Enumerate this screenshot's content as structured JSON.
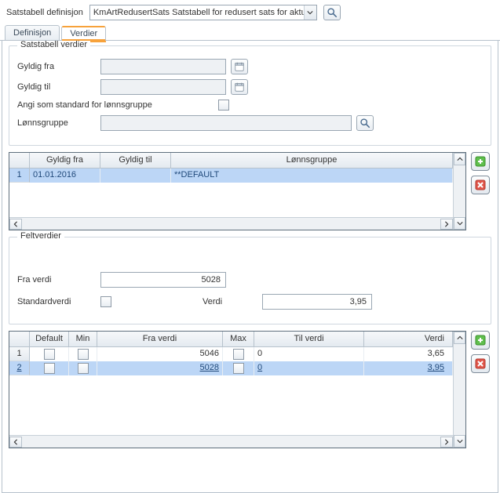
{
  "top": {
    "label": "Satstabell definisjon",
    "combo_value": "KmArtRedusertSats Satstabell for redusert sats for aktuell art"
  },
  "tabs": {
    "definition": "Definisjon",
    "values": "Verdier",
    "active": "values"
  },
  "satstabell": {
    "legend": "Satstabell verdier",
    "gyldig_fra_label": "Gyldig fra",
    "gyldig_fra_value": "",
    "gyldig_til_label": "Gyldig til",
    "gyldig_til_value": "",
    "std_lonn_label": "Angi som standard for lønnsgruppe",
    "std_lonn_checked": false,
    "lonnsgruppe_label": "Lønnsgruppe",
    "lonnsgruppe_value": ""
  },
  "grid1": {
    "cols": {
      "gyldig_fra": "Gyldig fra",
      "gyldig_til": "Gyldig til",
      "lonnsgruppe": "Lønnsgruppe"
    },
    "rows": [
      {
        "n": "1",
        "gyldig_fra": "01.01.2016",
        "gyldig_til": "",
        "lonnsgruppe": "**DEFAULT"
      }
    ]
  },
  "feltverdier": {
    "legend": "Feltverdier",
    "fra_verdi_label": "Fra verdi",
    "fra_verdi_value": "5028",
    "standardverdi_label": "Standardverdi",
    "standardverdi_checked": false,
    "verdi_label": "Verdi",
    "verdi_value": "3,95"
  },
  "grid2": {
    "cols": {
      "default": "Default",
      "min": "Min",
      "fra_verdi": "Fra verdi",
      "max": "Max",
      "til_verdi": "Til verdi",
      "verdi": "Verdi"
    },
    "rows": [
      {
        "n": "1",
        "default": false,
        "min": false,
        "fra_verdi": "5046",
        "max": false,
        "til_verdi": "0",
        "verdi": "3,65"
      },
      {
        "n": "2",
        "default": false,
        "min": false,
        "fra_verdi": "5028",
        "max": false,
        "til_verdi": "0",
        "verdi": "3,95"
      }
    ]
  }
}
